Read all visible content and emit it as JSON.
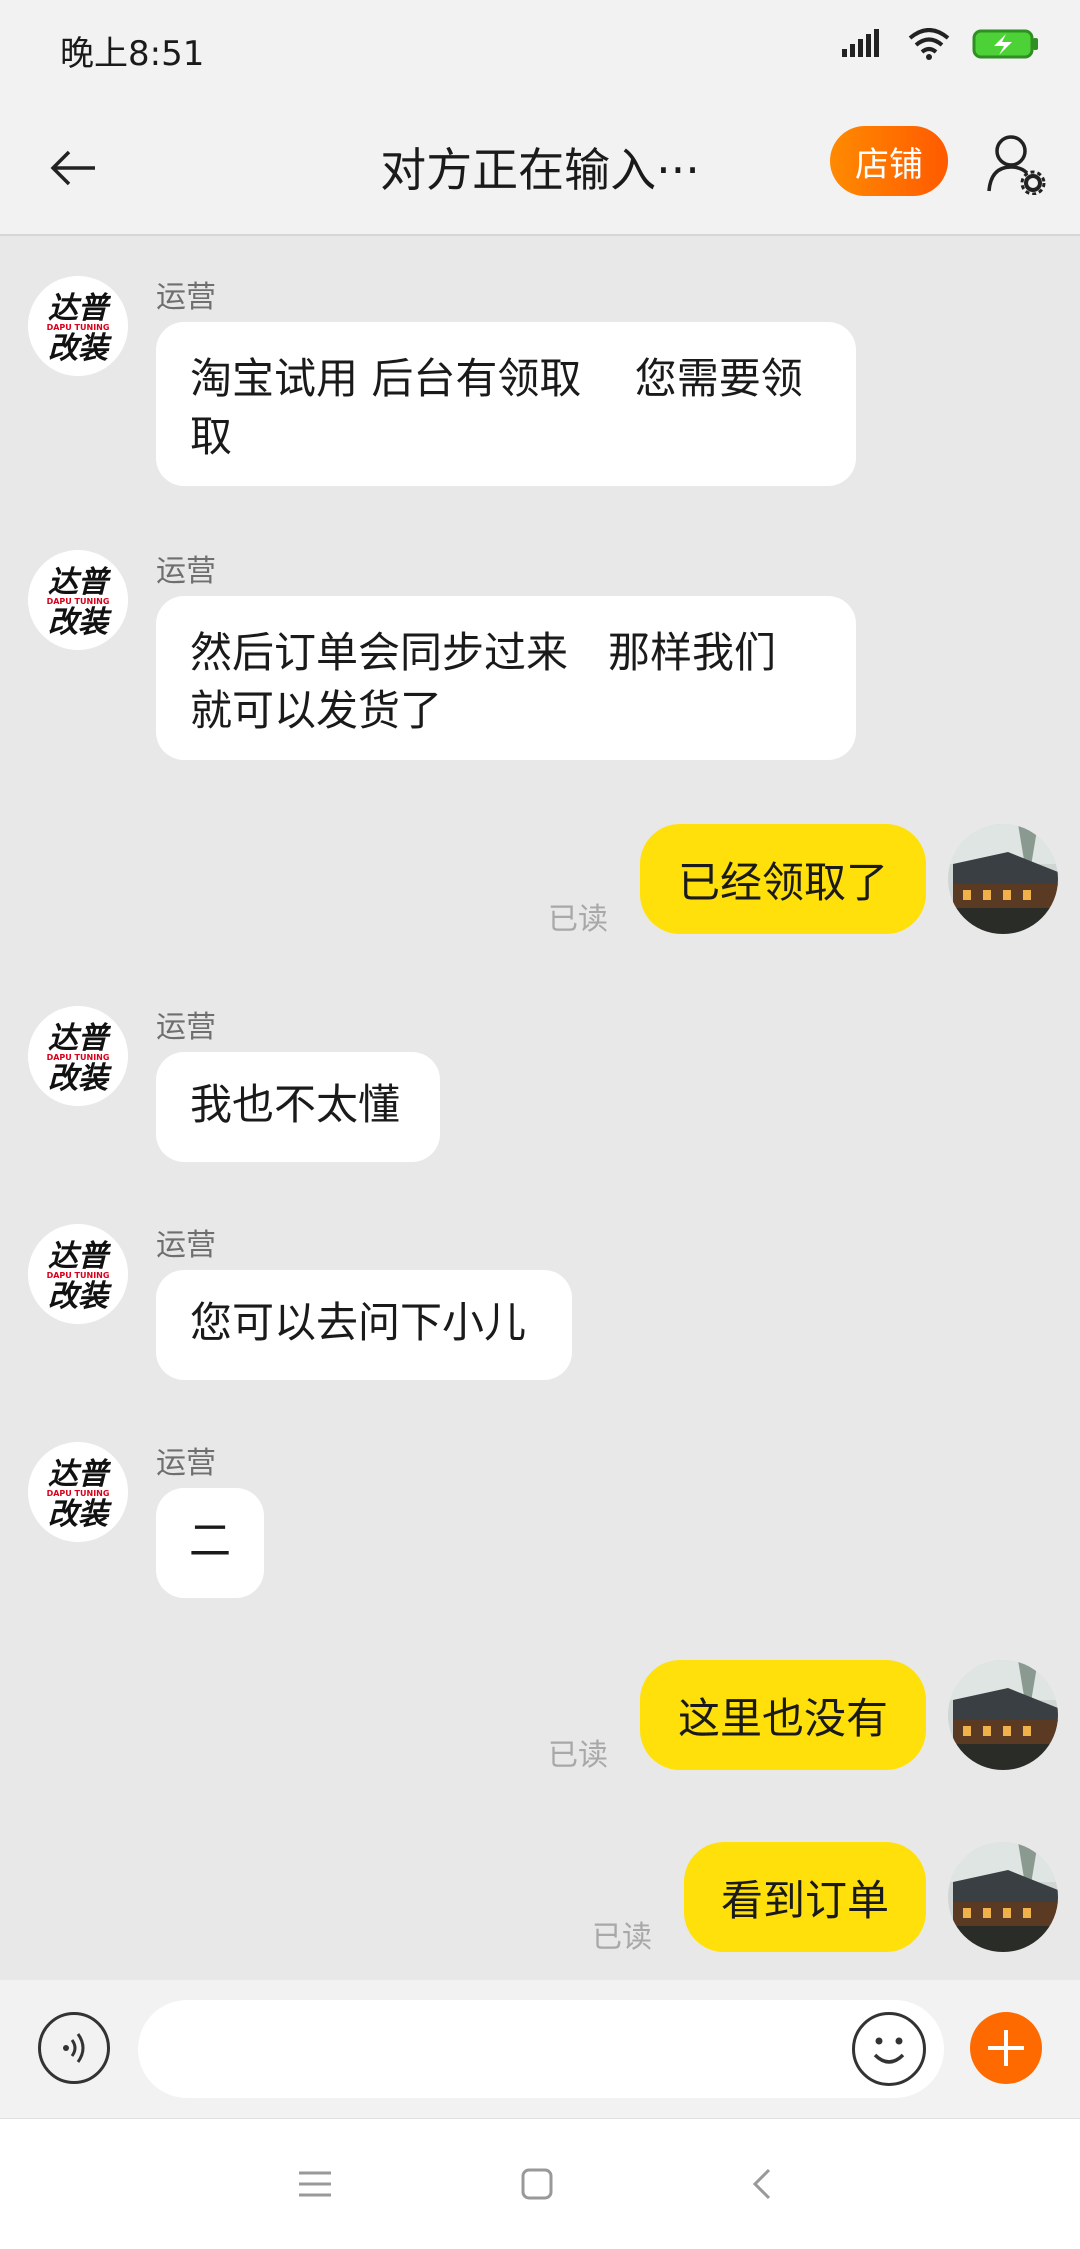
{
  "status_bar": {
    "time": "晚上8:51"
  },
  "nav": {
    "title": "对方正在输入···",
    "shop_label": "店铺"
  },
  "messages": [
    {
      "side": "left",
      "sender": "运营",
      "text": "淘宝试用 后台有领取    您需要领\n取"
    },
    {
      "side": "left",
      "sender": "运营",
      "text": "然后订单会同步过来   那样我们\n就可以发货了"
    },
    {
      "side": "right",
      "text": "已经领取了",
      "status": "已读"
    },
    {
      "side": "left",
      "sender": "运营",
      "text": "我也不太懂"
    },
    {
      "side": "left",
      "sender": "运营",
      "text": "您可以去问下小儿"
    },
    {
      "side": "left",
      "sender": "运营",
      "text": "二"
    },
    {
      "side": "right",
      "text": "这里也没有",
      "status": "已读"
    },
    {
      "side": "right",
      "text": "看到订单",
      "status": "已读"
    }
  ],
  "shop_avatar": {
    "brand_text": "达普",
    "sub_text": "DAPU TUNING",
    "line2": "改装"
  },
  "input": {
    "placeholder": ""
  },
  "colors": {
    "accent": "#ff6a00",
    "bubble_mine": "#ffe00a",
    "bubble_theirs": "#ffffff",
    "background": "#e8e8e8"
  }
}
